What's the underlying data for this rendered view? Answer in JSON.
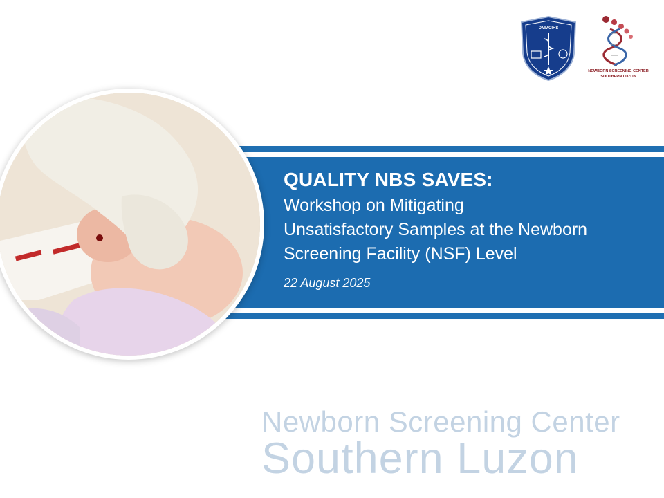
{
  "slide": {
    "title": "QUALITY NBS SAVES:",
    "subtitle_lines": [
      "Workshop on Mitigating",
      "Unsatisfactory Samples at the Newborn",
      "Screening Facility (NSF) Level"
    ],
    "date": "22 August 2025"
  },
  "logos": {
    "left_shield_text": "DMMCIHS",
    "right_caption_line1": "NEWBORN SCREENING CENTER",
    "right_caption_line2": "SOUTHERN LUZON"
  },
  "watermark": {
    "line1": "Newborn Screening Center",
    "line2": "Southern Luzon"
  },
  "colors": {
    "banner_blue": "#1c6cb0",
    "watermark": "#c3d3e3",
    "logo_red": "#8a1c22"
  }
}
